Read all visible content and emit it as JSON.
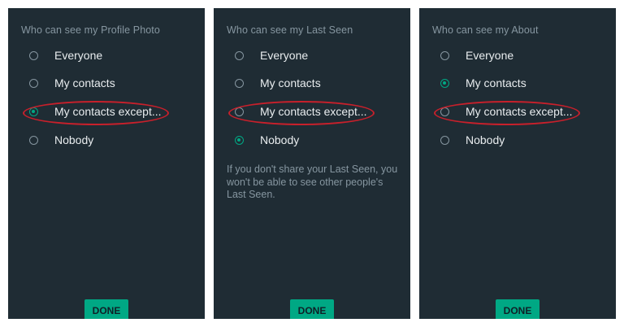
{
  "panels": [
    {
      "title": "Who can see my Profile Photo",
      "options": [
        {
          "label": "Everyone",
          "selected": false
        },
        {
          "label": "My contacts",
          "selected": false
        },
        {
          "label": "My contacts except...",
          "selected": true
        },
        {
          "label": "Nobody",
          "selected": false
        }
      ],
      "note": "",
      "done_label": "DONE",
      "highlighted_option": 2
    },
    {
      "title": "Who can see my Last Seen",
      "options": [
        {
          "label": "Everyone",
          "selected": false
        },
        {
          "label": "My contacts",
          "selected": false
        },
        {
          "label": "My contacts except...",
          "selected": false
        },
        {
          "label": "Nobody",
          "selected": true
        }
      ],
      "note": "If you don't share your Last Seen, you won't be able to see other people's Last Seen.",
      "done_label": "DONE",
      "highlighted_option": 2
    },
    {
      "title": "Who can see my About",
      "options": [
        {
          "label": "Everyone",
          "selected": false
        },
        {
          "label": "My contacts",
          "selected": true
        },
        {
          "label": "My contacts except...",
          "selected": false
        },
        {
          "label": "Nobody",
          "selected": false
        }
      ],
      "note": "",
      "done_label": "DONE",
      "highlighted_option": 2
    }
  ],
  "colors": {
    "panel_bg": "#1f2c34",
    "accent": "#00a884",
    "text_primary": "#e9edef",
    "text_secondary": "#8696a0",
    "annotation": "#c8202b"
  },
  "icons": {
    "radio_selected": "radio-selected-icon",
    "radio_unselected": "radio-unselected-icon"
  }
}
